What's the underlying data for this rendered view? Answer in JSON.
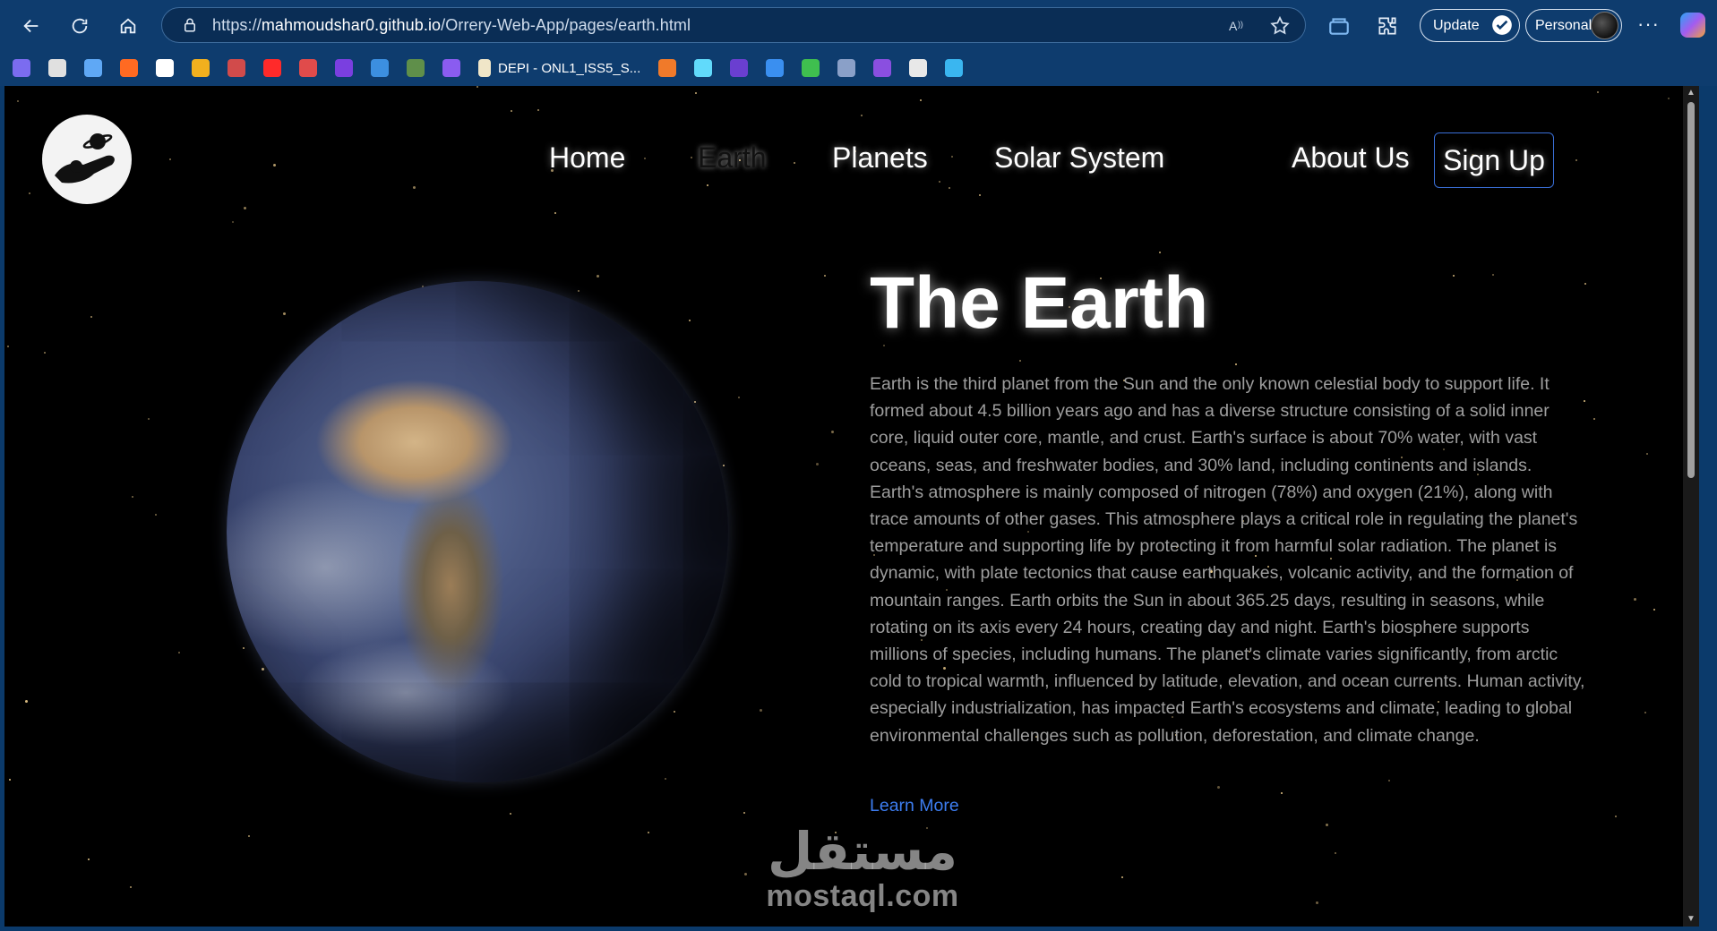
{
  "browser": {
    "url_prefix": "https://",
    "url_host": "mahmoudshar0.github.io",
    "url_path": "/Orrery-Web-App/pages/earth.html",
    "update_label": "Update",
    "profile_label": "Personal",
    "more_label": "···",
    "bookmarks": [
      {
        "icon": "copilot-bookmark-icon",
        "color": "#7b6cf0"
      },
      {
        "icon": "openai-icon",
        "color": "#e0e0e0"
      },
      {
        "icon": "gemini-icon",
        "color": "#5fa8f5"
      },
      {
        "icon": "soundcloud-icon",
        "color": "#ff6a22"
      },
      {
        "icon": "github-icon",
        "color": "#ffffff"
      },
      {
        "icon": "chart-icon",
        "color": "#f2b01e"
      },
      {
        "icon": "cloud-icon",
        "color": "#d14b4b"
      },
      {
        "icon": "youtube-icon",
        "color": "#ff2a2a"
      },
      {
        "icon": "disc-icon",
        "color": "#e04b4b"
      },
      {
        "icon": "bootstrap-icon",
        "color": "#7a3fe0"
      },
      {
        "icon": "e-icon",
        "color": "#3c8fe0"
      },
      {
        "icon": "seal-icon",
        "color": "#5f8f4a"
      },
      {
        "icon": "grid-icon",
        "color": "#8a5cf0"
      }
    ],
    "bookmark_text": "DEPI - ONL1_ISS5_S...",
    "bookmarks_after": [
      {
        "icon": "bolt-icon",
        "color": "#f07a2a"
      },
      {
        "icon": "react-icon",
        "color": "#61dafb"
      },
      {
        "icon": "lightning-icon",
        "color": "#6a3fd0"
      },
      {
        "icon": "wave-icon",
        "color": "#3a8ff0"
      },
      {
        "icon": "hexagon-icon",
        "color": "#3fbf4f"
      },
      {
        "icon": "image-icon",
        "color": "#8aa0c8"
      },
      {
        "icon": "shield-icon",
        "color": "#8a4fe0"
      },
      {
        "icon": "card-icon",
        "color": "#e8e8e8"
      },
      {
        "icon": "tailwind-icon",
        "color": "#3ab6f0"
      }
    ]
  },
  "nav": {
    "home": "Home",
    "earth": "Earth",
    "planets": "Planets",
    "solar_system": "Solar System",
    "about": "About Us",
    "signup": "Sign Up"
  },
  "hero": {
    "title": "The Earth",
    "description": "Earth is the third planet from the Sun and the only known celestial body to support life. It formed about 4.5 billion years ago and has a diverse structure consisting of a solid inner core, liquid outer core, mantle, and crust. Earth's surface is about 70% water, with vast oceans, seas, and freshwater bodies, and 30% land, including continents and islands. Earth's atmosphere is mainly composed of nitrogen (78%) and oxygen (21%), along with trace amounts of other gases. This atmosphere plays a critical role in regulating the planet's temperature and supporting life by protecting it from harmful solar radiation. The planet is dynamic, with plate tectonics that cause earthquakes, volcanic activity, and the formation of mountain ranges. Earth orbits the Sun in about 365.25 days, resulting in seasons, while rotating on its axis every 24 hours, creating day and night. Earth's biosphere supports millions of species, including humans. The planet's climate varies significantly, from arctic cold to tropical warmth, influenced by latitude, elevation, and ocean currents. Human activity, especially industrialization, has impacted Earth's ecosystems and climate, leading to global environmental challenges such as pollution, deforestation, and climate change.",
    "learn_more": "Learn More"
  },
  "watermark": {
    "arabic": "مستقل",
    "latin": "mostaql.com"
  },
  "colors": {
    "chrome_bg": "#0e3c6e",
    "page_bg": "#000000",
    "link_blue": "#3d7df0",
    "signup_border": "#3a6fd8",
    "body_text": "#9e9e9e"
  }
}
